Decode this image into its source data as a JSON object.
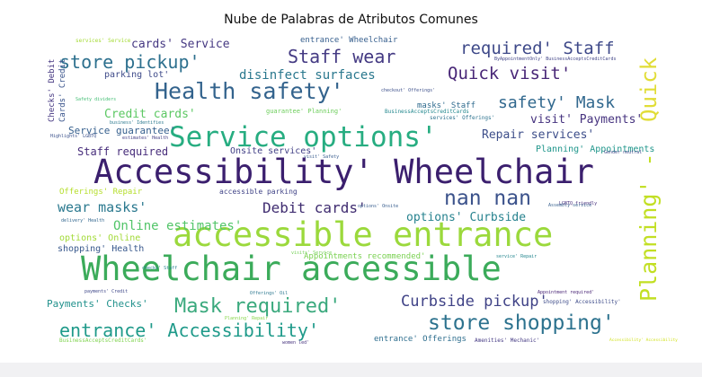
{
  "figure": {
    "title": "Nube de Palabras de Atributos Comunes"
  },
  "chart_data": {
    "type": "wordcloud",
    "title": "Nube de Palabras de Atributos Comunes",
    "words": [
      {
        "text": "Accessibility' Wheelchair",
        "weight": 100,
        "color": "#3b1f6e"
      },
      {
        "text": "Wheelchair accessible",
        "weight": 96,
        "color": "#3bab5a"
      },
      {
        "text": "accessible entrance",
        "weight": 94,
        "color": "#9bd93c"
      },
      {
        "text": "Service options'",
        "weight": 78,
        "color": "#27ad81"
      },
      {
        "text": "Health safety'",
        "weight": 62,
        "color": "#33638d"
      },
      {
        "text": "store shopping'",
        "weight": 58,
        "color": "#2c728e"
      },
      {
        "text": "Mask required'",
        "weight": 56,
        "color": "#3aa97d"
      },
      {
        "text": "entrance' Accessibility'",
        "weight": 50,
        "color": "#1f9a8a"
      },
      {
        "text": "Planning' -",
        "weight": 55,
        "color": "#c2df23"
      },
      {
        "text": "Quick",
        "weight": 52,
        "color": "#e1dd37"
      },
      {
        "text": "nan nan",
        "weight": 50,
        "color": "#3b528b"
      },
      {
        "text": "store pickup'",
        "weight": 48,
        "color": "#2d708e"
      },
      {
        "text": "Staff wear",
        "weight": 48,
        "color": "#443a83"
      },
      {
        "text": "Quick visit'",
        "weight": 44,
        "color": "#482677"
      },
      {
        "text": "required' Staff",
        "weight": 44,
        "color": "#3e4989"
      },
      {
        "text": "safety' Mask",
        "weight": 40,
        "color": "#31688e"
      },
      {
        "text": "Curbside pickup'",
        "weight": 38,
        "color": "#404387"
      },
      {
        "text": "wear masks'",
        "weight": 34,
        "color": "#29788e"
      },
      {
        "text": "Debit cards'",
        "weight": 34,
        "color": "#3f2c70"
      },
      {
        "text": "cards' Service",
        "weight": 28,
        "color": "#453882"
      },
      {
        "text": "disinfect surfaces",
        "weight": 30,
        "color": "#2a788e"
      },
      {
        "text": "Credit cards'",
        "weight": 26,
        "color": "#5cc863"
      },
      {
        "text": "Repair services'",
        "weight": 26,
        "color": "#3d4e8a"
      },
      {
        "text": "Online estimates'",
        "weight": 26,
        "color": "#52c569"
      },
      {
        "text": "options' Curbside",
        "weight": 24,
        "color": "#26828e"
      },
      {
        "text": "visit' Payments'",
        "weight": 22,
        "color": "#46337f"
      },
      {
        "text": "Service guarantee'",
        "weight": 20,
        "color": "#355f8d"
      },
      {
        "text": "Staff required",
        "weight": 20,
        "color": "#472d7b"
      },
      {
        "text": "Payments' Checks'",
        "weight": 20,
        "color": "#21918c"
      },
      {
        "text": "Appointments recommended'",
        "weight": 18,
        "color": "#7ad151"
      },
      {
        "text": "Onsite services'",
        "weight": 18,
        "color": "#424086"
      },
      {
        "text": "Planning' Appointments",
        "weight": 16,
        "color": "#1f968b"
      },
      {
        "text": "options' Online",
        "weight": 16,
        "color": "#a2da37"
      },
      {
        "text": "shopping' Health",
        "weight": 16,
        "color": "#38588c"
      },
      {
        "text": "parking lot'",
        "weight": 14,
        "color": "#3e4a89"
      },
      {
        "text": "accessible parking",
        "weight": 14,
        "color": "#414487"
      },
      {
        "text": "Offerings' Repair",
        "weight": 14,
        "color": "#b5de2b"
      },
      {
        "text": "masks' Staff",
        "weight": 14,
        "color": "#2f6b8e"
      },
      {
        "text": "guarantee' Planning'",
        "weight": 12,
        "color": "#6ccd5a"
      },
      {
        "text": "entrance' Offerings",
        "weight": 14,
        "color": "#2e6e8e"
      },
      {
        "text": "Checks' Debit",
        "weight": 14,
        "color": "#453781"
      },
      {
        "text": "Cards' Credit",
        "weight": 14,
        "color": "#3a548c"
      },
      {
        "text": "entrance' Wheelchair",
        "weight": 14,
        "color": "#355e8d"
      },
      {
        "text": "services' Service",
        "weight": 8,
        "color": "#a5db36"
      },
      {
        "text": "BusinessAcceptsCreditCards",
        "weight": 7,
        "color": "#23888e"
      },
      {
        "text": "BusinessAcceptsCreditCards'",
        "weight": 7,
        "color": "#7fd34e"
      },
      {
        "text": "ByAppointmentOnly' BusinessAcceptsCreditCards",
        "weight": 6,
        "color": "#414487"
      },
      {
        "text": "services' Offerings'",
        "weight": 7,
        "color": "#2c728e"
      },
      {
        "text": "visits' Service",
        "weight": 6,
        "color": "#73d055"
      },
      {
        "text": "options' Onsite",
        "weight": 6,
        "color": "#365c8d"
      },
      {
        "text": "service' Repair",
        "weight": 6,
        "color": "#24868e"
      },
      {
        "text": "Amenities' Mechanic'",
        "weight": 6,
        "color": "#443983"
      },
      {
        "text": "Offerings' Oil",
        "weight": 6,
        "color": "#2a768e"
      },
      {
        "text": "shopping' Accessibility'",
        "weight": 6,
        "color": "#3e4c8a"
      },
      {
        "text": "payments' Credit",
        "weight": 6,
        "color": "#3f4889"
      },
      {
        "text": "women led'",
        "weight": 5,
        "color": "#46327e"
      },
      {
        "text": "delivery' Health",
        "weight": 6,
        "color": "#31668e"
      },
      {
        "text": "checks' Staff",
        "weight": 5,
        "color": "#26818e"
      },
      {
        "text": "Appointment required'",
        "weight": 5,
        "color": "#482475"
      },
      {
        "text": "Accessibility' Accessibility",
        "weight": 5,
        "color": "#d0e11c"
      },
      {
        "text": "Safety dividers",
        "weight": 5,
        "color": "#40bd72"
      },
      {
        "text": "Highlights' LGBTQ",
        "weight": 5,
        "color": "#3b518b"
      },
      {
        "text": "estimates' Health",
        "weight": 5,
        "color": "#433e85"
      },
      {
        "text": "business' Identifies",
        "weight": 5,
        "color": "#2a788e"
      },
      {
        "text": "visit' Safety",
        "weight": 5,
        "color": "#375b8d"
      },
      {
        "text": "Planning' Repair",
        "weight": 5,
        "color": "#87d549"
      },
      {
        "text": "LGBTQ friendly",
        "weight": 5,
        "color": "#472f7d"
      },
      {
        "text": "Assembly service",
        "weight": 5,
        "color": "#355f8d"
      },
      {
        "text": "checkout' Offerings'",
        "weight": 5,
        "color": "#3c4f8a"
      },
      {
        "text": "Gender neutral",
        "weight": 5,
        "color": "#3e4a89"
      }
    ]
  }
}
